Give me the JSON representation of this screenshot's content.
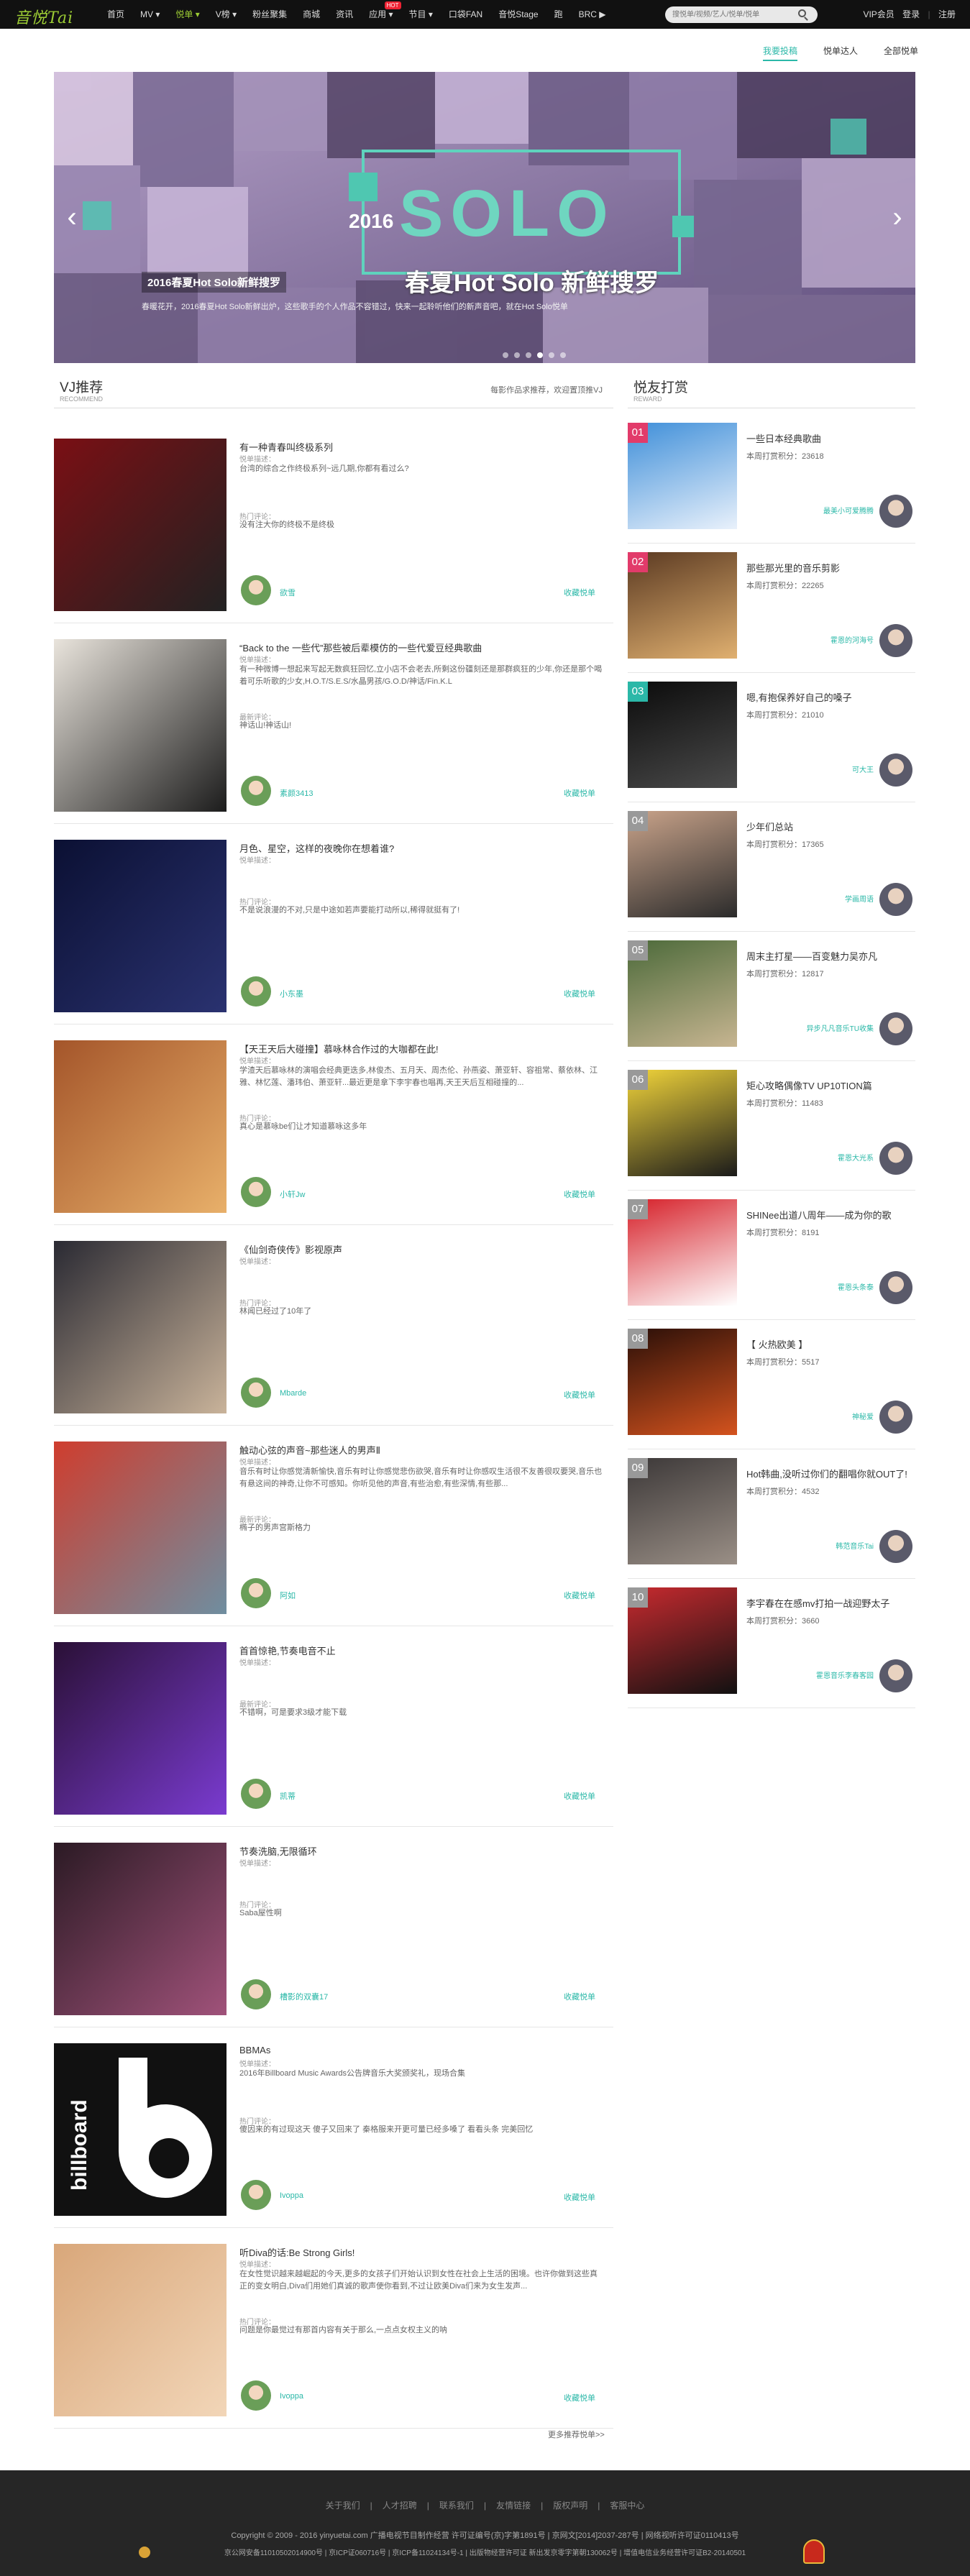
{
  "brand": {
    "logo": "音悦Tai",
    "accent": "#2bb8a8",
    "logo_color": "#9ccc34"
  },
  "nav": {
    "items": [
      {
        "label": "首页"
      },
      {
        "label": "MV ▾"
      },
      {
        "label": "悦单 ▾",
        "active": true
      },
      {
        "label": "V榜 ▾"
      },
      {
        "label": "粉丝聚集"
      },
      {
        "label": "商城"
      },
      {
        "label": "资讯"
      },
      {
        "label": "应用 ▾",
        "badge": "HOT"
      },
      {
        "label": "节目 ▾"
      },
      {
        "label": "口袋FAN"
      },
      {
        "label": "音悦Stage"
      },
      {
        "label": "跑"
      },
      {
        "label": "BRC ▶"
      }
    ],
    "search_placeholder": "搜悦单/视频/艺人/悦单/悦单",
    "vip": "VIP会员",
    "login": "登录",
    "register": "注册"
  },
  "subtabs": [
    {
      "label": "我要投稿",
      "active": true
    },
    {
      "label": "悦单达人"
    },
    {
      "label": "全部悦单"
    }
  ],
  "banner": {
    "year": "2016",
    "word": "SOLO",
    "slogan": "春夏Hot Solo 新鲜搜罗",
    "caption": "2016春夏Hot Solo新鲜搜罗",
    "desc": "春暖花开，2016春夏Hot Solo新鲜出炉，这些歌手的个人作品不容错过，快来一起聆听他们的新声音吧，就在Hot Solo悦单",
    "prev": "‹",
    "next": "›"
  },
  "vj_section": {
    "title": "VJ推荐",
    "sub": "RECOMMEND",
    "right": "每影作品求推荐，欢迎置顶推VJ"
  },
  "vj_items": [
    {
      "title": "有一种青春叫终极系列",
      "desc_label": "悦单描述：",
      "desc": "台湾的综合之作终极系列~远几期,你都有看过么?",
      "comment_label": "热门评论：",
      "comment": "没有注大你的终极不是终极",
      "user": "欲雪",
      "fav": "收藏悦单"
    },
    {
      "title": "“Back to the 一些代”那些被后辈模仿的一些代爱豆经典歌曲",
      "desc_label": "悦单描述：",
      "desc": "有一种微博一想起来写起无数疯狂回忆,立小店不会老去,所剩这份疆刻还是那群疯狂的少年,你还是那个喝着可乐听歌的少女,H.O.T/S.E.S/水晶男孩/G.O.D/神话/Fin.K.L",
      "comment_label": "最新评论：",
      "comment": "神话山!神话山!",
      "user": "素颜3413",
      "fav": "收藏悦单"
    },
    {
      "title": "月色、星空，这样的夜晚你在想着谁?",
      "desc_label": "悦单描述：",
      "desc": "",
      "comment_label": "热门评论：",
      "comment": "不是说浪漫的不对,只是中途如若声要能打动所以,稀得就挺有了!",
      "user": "小东墨",
      "fav": "收藏悦单"
    },
    {
      "title": "【天王天后大碰撞】慕咏林合作过的大咖都在此!",
      "desc_label": "悦单描述：",
      "desc": "学渣天后慕咏林的演唱会经典更迭多,林俊杰、五月天、周杰伦、孙燕姿、萧亚轩、容祖常、蔡依林、江雅、林忆莲、潘玮伯、萧亚轩...最近更是拿下李宇春也唱再,天王天后互相碰撞的...",
      "comment_label": "热门评论：",
      "comment": "真心是慕咏be们让才知道慕咏这多年",
      "user": "小轩Jw",
      "fav": "收藏悦单"
    },
    {
      "title": "《仙剑奇侠传》影视原声",
      "desc_label": "悦单描述：",
      "desc": "",
      "comment_label": "热门评论：",
      "comment": "林闻已经过了10年了",
      "user": "Mbarde",
      "fav": "收藏悦单"
    },
    {
      "title": "触动心弦的声音~那些迷人的男声Ⅱ",
      "desc_label": "悦单描述：",
      "desc": "音乐有时让你感觉清新愉快,音乐有时让你感觉悲伤欲哭,音乐有时让你感叹生活很不友善很叹要哭,音乐也有悬这间的神奇,让你不可感知。你听见他的声音,有些治愈,有些深情,有些那...",
      "comment_label": "最新评论：",
      "comment": "椭子的男声宫斯格力",
      "user": "阿如",
      "fav": "收藏悦单"
    },
    {
      "title": "首首惊艳,节奏电音不止",
      "desc_label": "悦单描述：",
      "desc": "",
      "comment_label": "最新评论：",
      "comment": "不错啊，可是要求3级才能下载",
      "user": "凯蒂",
      "fav": "收藏悦单"
    },
    {
      "title": "节奏洗脑,无限循环",
      "desc_label": "悦单描述：",
      "desc": "",
      "comment_label": "热门评论：",
      "comment": "Saba屋性啊",
      "user": "槽影的双囊17",
      "fav": "收藏悦单"
    },
    {
      "title": "BBMAs",
      "desc_label": "悦单描述：",
      "desc": "2016年Billboard Music Awards公告牌音乐大奖颁奖礼，现场合集",
      "comment_label": "热门评论：",
      "comment": "傻因来的有过现这天 傻子又回来了 秦格服来开更可量已经多嗓了 看看头条 完美回忆",
      "user": "Ivoppa",
      "fav": "收藏悦单"
    },
    {
      "title": "听Diva的话:Be Strong Girls!",
      "desc_label": "悦单描述：",
      "desc": "在女性觉识越来越崛起的今天,更多的女孩子们开始认识到女性在社会上生活的困境。也许你做到这些真正的变女明白,Diva们用她们真诚的歌声使你看到,不过让欧美Diva们来为女生发声...",
      "comment_label": "热门评论：",
      "comment": "问题是你最觉过有那首内容有关于那么,一点点女权主义的呐",
      "user": "Ivoppa",
      "fav": "收藏悦单"
    }
  ],
  "more": "更多推荐悦单>>",
  "reward_section": {
    "title": "悦友打赏",
    "sub": "REWARD"
  },
  "reward_items": [
    {
      "rank": "01",
      "title": "一些日本经典歌曲",
      "score_label": "本周打赏积分：",
      "score": "23618",
      "nick": "最美小可爱腾腾",
      "rank_color": "#e23b6a"
    },
    {
      "rank": "02",
      "title": "那些那光里的音乐剪影",
      "score_label": "本周打赏积分：",
      "score": "22265",
      "nick": "霍恩的河海号",
      "rank_color": "#e23b6a"
    },
    {
      "rank": "03",
      "title": "嗯,有抱保养好自己的嗓子",
      "score_label": "本周打赏积分：",
      "score": "21010",
      "nick": "可大王",
      "rank_color": "#2bb8a8"
    },
    {
      "rank": "04",
      "title": "少年们总站",
      "score_label": "本周打赏积分：",
      "score": "17365",
      "nick": "学画周语",
      "rank_color": "#999999"
    },
    {
      "rank": "05",
      "title": "周末主打星——百变魅力吴亦凡",
      "score_label": "本周打赏积分：",
      "score": "12817",
      "nick": "异步凡凡音乐TU收集",
      "rank_color": "#999999"
    },
    {
      "rank": "06",
      "title": "矩心攻略偶像TV UP10TION篇",
      "score_label": "本周打赏积分：",
      "score": "11483",
      "nick": "霍恩大光系",
      "rank_color": "#999999"
    },
    {
      "rank": "07",
      "title": "SHINee出道八周年——成为你的歌",
      "score_label": "本周打赏积分：",
      "score": "8191",
      "nick": "霍恩头条泰",
      "rank_color": "#999999"
    },
    {
      "rank": "08",
      "title": "【 火热欧美 】",
      "score_label": "本周打赏积分：",
      "score": "5517",
      "nick": "神秘爱",
      "rank_color": "#999999"
    },
    {
      "rank": "09",
      "title": "Hot韩曲,没听过你们的翻唱你就OUT了!",
      "score_label": "本周打赏积分：",
      "score": "4532",
      "nick": "韩范音乐Tai",
      "rank_color": "#999999"
    },
    {
      "rank": "10",
      "title": "李宇春在在感mv打拍一战迎野太子",
      "score_label": "本周打赏积分：",
      "score": "3660",
      "nick": "霍恩音乐李春客园",
      "rank_color": "#999999"
    }
  ],
  "footer": {
    "links": [
      "关于我们",
      "人才招聘",
      "联系我们",
      "友情链接",
      "版权声明",
      "客服中心"
    ],
    "copyright": "Copyright © 2009 - 2016 yinyuetai.com 广播电视节目制作经营 许可证编号(京)字第1891号 | 京网文[2014]2037-287号 | 网络视听许可证0110413号",
    "license": "京公网安备11010502014900号 | 京ICP证060716号 | 京ICP备11024134号-1 | 出版物经营许可证 新出发京零字第朝130062号 | 增值电信业务经营许可证B2-20140501"
  }
}
